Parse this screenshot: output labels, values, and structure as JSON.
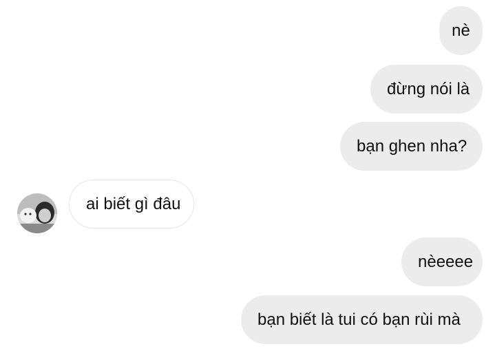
{
  "conversation": {
    "messages": [
      {
        "direction": "outgoing",
        "text": "nè"
      },
      {
        "direction": "outgoing",
        "text": "đừng nói là"
      },
      {
        "direction": "outgoing",
        "text": "bạn ghen nha?"
      },
      {
        "direction": "incoming",
        "text": "ai biết gì đâu"
      },
      {
        "direction": "outgoing",
        "text": "nèeeee"
      },
      {
        "direction": "outgoing",
        "text": "bạn biết là tui có bạn rùi mà"
      }
    ],
    "contact_avatar": "profile-photo-avatar"
  },
  "colors": {
    "background": "#ffffff",
    "outgoing_bubble": "#ececec",
    "incoming_bubble_border": "#e6e6e6",
    "text": "#111111"
  }
}
